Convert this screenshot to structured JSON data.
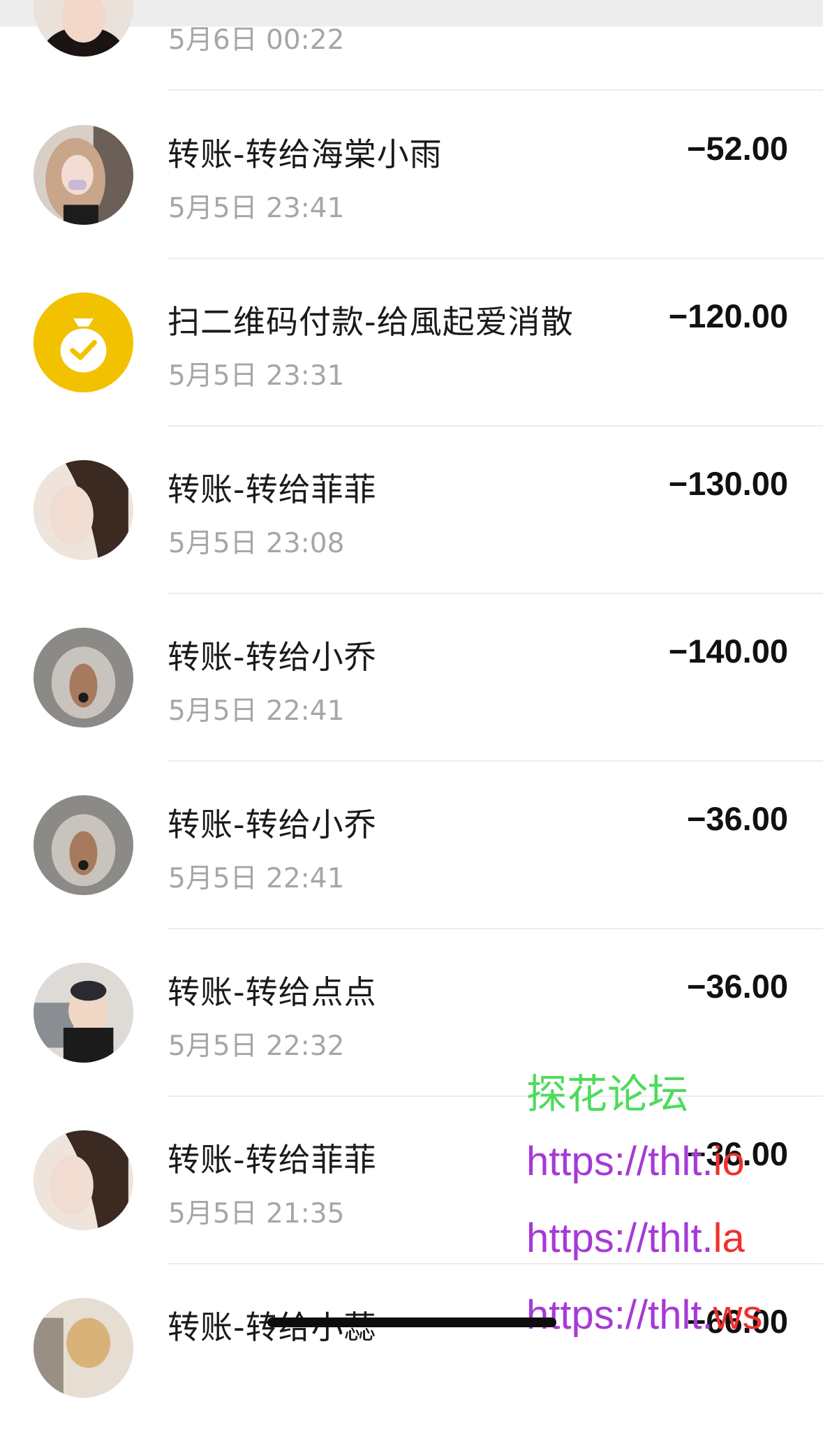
{
  "transactions": [
    {
      "title": "",
      "time": "5月6日 00:22",
      "amount": "",
      "avatar": "woman-dark-hair"
    },
    {
      "title": "转账-转给海棠小雨",
      "time": "5月5日 23:41",
      "amount": "−52.00",
      "avatar": "woman-light-hair"
    },
    {
      "title": "扫二维码付款-给風起爱消散",
      "time": "5月5日 23:31",
      "amount": "−120.00",
      "avatar": "money-bag-icon"
    },
    {
      "title": "转账-转给菲菲",
      "time": "5月5日 23:08",
      "amount": "−130.00",
      "avatar": "woman-long-hair"
    },
    {
      "title": "转账-转给小乔",
      "time": "5月5日 22:41",
      "amount": "−140.00",
      "avatar": "dog-face"
    },
    {
      "title": "转账-转给小乔",
      "time": "5月5日 22:41",
      "amount": "−36.00",
      "avatar": "dog-face"
    },
    {
      "title": "转账-转给点点",
      "time": "5月5日 22:32",
      "amount": "−36.00",
      "avatar": "child-laptop"
    },
    {
      "title": "转账-转给菲菲",
      "time": "5月5日 21:35",
      "amount": "−36.00",
      "avatar": "woman-long-hair"
    },
    {
      "title": "转账-转给小蕊",
      "time": "",
      "amount": "−66.00",
      "avatar": "woman-blonde"
    }
  ],
  "watermark": {
    "forum_name": "探花论坛",
    "urls": [
      {
        "prefix": "https://thlt.",
        "tld": "io"
      },
      {
        "prefix": "https://thlt.",
        "tld": "la"
      },
      {
        "prefix": "https://thlt.",
        "tld": "ws"
      }
    ]
  },
  "colors": {
    "yellow_icon": "#F2C200",
    "time_gray": "#A6A6A6",
    "watermark_green": "#4CDC5B",
    "watermark_purple": "#A53AD7",
    "watermark_red": "#F0302E"
  }
}
